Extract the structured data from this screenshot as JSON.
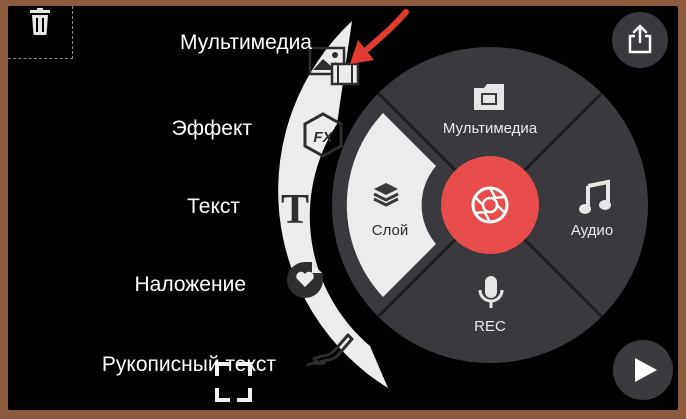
{
  "side_menu": {
    "items": [
      {
        "label": "Мультимедиа",
        "icon": "media-image-icon"
      },
      {
        "label": "Эффект",
        "icon": "fx-icon"
      },
      {
        "label": "Текст",
        "icon": "text-t-icon"
      },
      {
        "label": "Наложение",
        "icon": "sticker-icon"
      },
      {
        "label": "Рукописный текст",
        "icon": "pen-icon"
      }
    ]
  },
  "wheel": {
    "top_label": "Мультимедиа",
    "right_label": "Аудио",
    "bottom_label": "REC",
    "left_label": "Слой"
  },
  "colors": {
    "record_button": "#e84d4d",
    "arrow": "#e23b32",
    "wheel": "#3a3a3e",
    "arc_menu": "#ececec"
  }
}
